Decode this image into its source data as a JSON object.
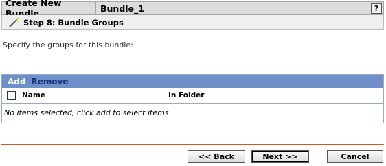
{
  "titlebar": {
    "title": "Create New Bundle",
    "bundle_name": "Bundle_1",
    "help_label": "?"
  },
  "step": {
    "label": "Step 8: Bundle Groups",
    "icon": "wand-icon"
  },
  "instructions": "Specify the groups for this bundle:",
  "panel": {
    "add_label": "Add",
    "remove_label": "Remove",
    "columns": [
      "Name",
      "In Folder"
    ],
    "empty_message": "No items selected, click add to select items"
  },
  "buttons": {
    "back_label": "<< Back",
    "next_label": "Next >>",
    "cancel_label": "Cancel"
  },
  "colors": {
    "toolbar": "#6e8fc7",
    "divider": "#c85a2a",
    "remove_link": "#1a2f80"
  }
}
